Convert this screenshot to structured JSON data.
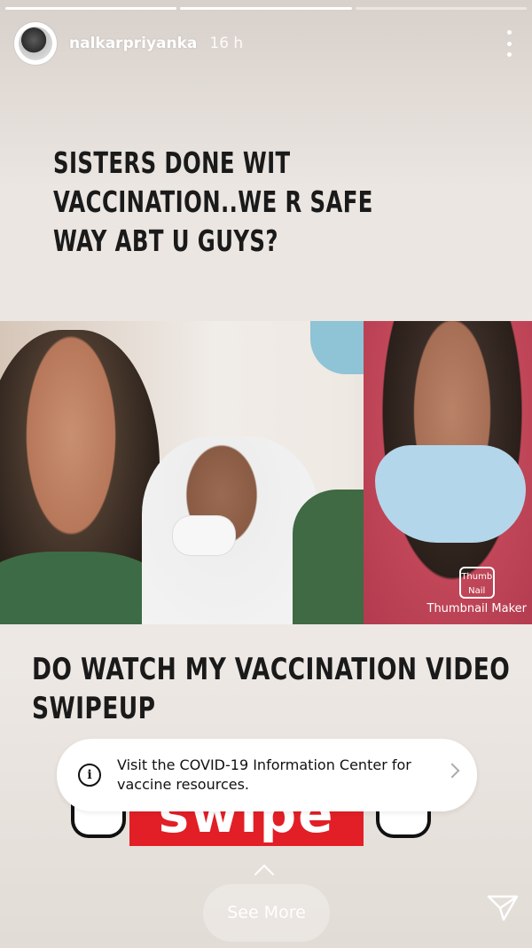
{
  "story": {
    "progress": [
      1.0,
      1.0,
      0.0
    ]
  },
  "header": {
    "username": "nalkarpriyanka",
    "time": "16 h",
    "menu_icon": "more-vertical-icon"
  },
  "caption_top": {
    "lines": [
      "SISTERS DONE WIT",
      "VACCINATION..WE R SAFE",
      "WAY ABT U GUYS?"
    ]
  },
  "photo": {
    "watermark_logo": "Thumb Nail",
    "watermark_text": "Thumbnail Maker"
  },
  "caption_bottom": {
    "lines": [
      "DO WATCH MY VACCINATION VIDEO",
      "SWIPEUP"
    ]
  },
  "swipe_graphic": {
    "text": "swipe up",
    "color": "#e21f26"
  },
  "info_banner": {
    "icon": "info-icon",
    "text": "Visit the COVID-19 Information Center for vaccine resources."
  },
  "footer": {
    "see_more": "See More",
    "send_icon": "send-direct-icon",
    "up_icon": "chevron-up-icon"
  }
}
